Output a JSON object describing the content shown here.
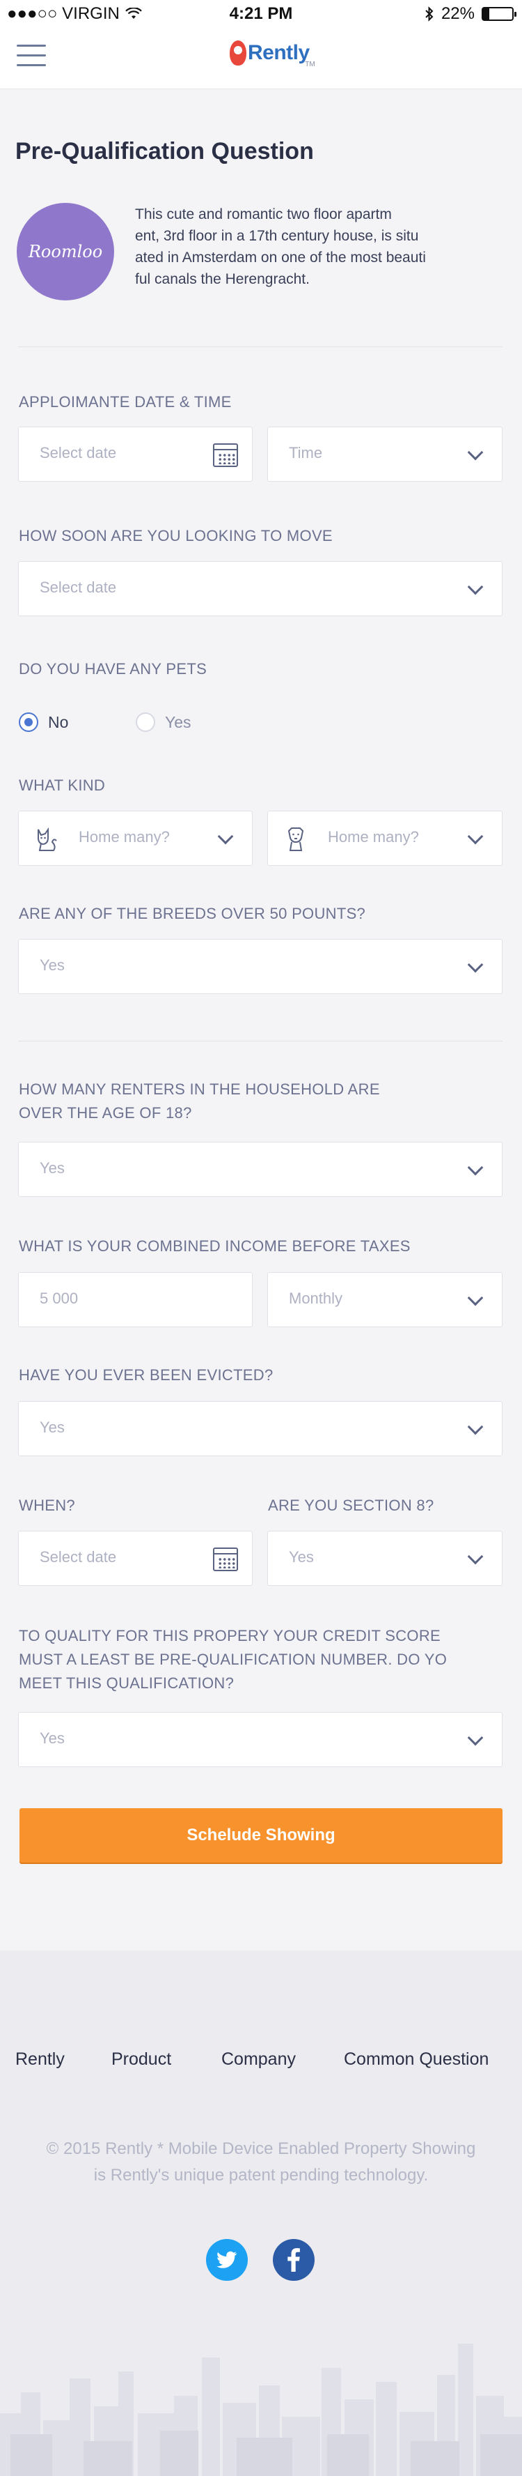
{
  "status": {
    "carrier": "●●●○○ VIRGIN",
    "time": "4:21 PM",
    "battery": "22%",
    "battery_level": 0.22
  },
  "brand": {
    "name": "Rently",
    "tm": "TM"
  },
  "page_title": "Pre-Qualification Question",
  "profile": {
    "avatar_text": "Roomloo",
    "lines": [
      "This cute and romantic two floor apartm",
      "ent, 3rd floor in a 17th century house, is situ",
      "ated in  Amsterdam on one of the most beauti",
      "ful canals  the Herengracht."
    ]
  },
  "appointment": {
    "label": "APPLOIMANTE DATE & TIME",
    "date_placeholder": "Select date",
    "time_placeholder": "Time"
  },
  "move": {
    "label": "HOW SOON ARE YOU LOOKING TO MOVE",
    "placeholder": "Select date"
  },
  "pets": {
    "label": "DO YOU HAVE ANY PETS",
    "options": [
      "No",
      "Yes"
    ],
    "selected": "No"
  },
  "kind": {
    "label": "WHAT KIND",
    "cat_placeholder": "Home many?",
    "dog_placeholder": "Home many?"
  },
  "breeds": {
    "label": "ARE ANY OF THE BREEDS OVER 50 POUNTS?",
    "value": "Yes"
  },
  "renters": {
    "label_line1": "HOW MANY RENTERS IN THE HOUSEHOLD ARE",
    "label_line2": "OVER THE AGE OF 18?",
    "value": "Yes"
  },
  "income": {
    "label": "WHAT IS YOUR COMBINED INCOME BEFORE TAXES",
    "amount": "5 000",
    "period": "Monthly"
  },
  "evicted": {
    "label": "HAVE YOU EVER BEEN EVICTED?",
    "value": "Yes"
  },
  "when": {
    "label": "WHEN?",
    "placeholder": "Select date"
  },
  "section8": {
    "label": "ARE YOU SECTION 8?",
    "value": "Yes"
  },
  "credit": {
    "label_line1": "TO QUALITY FOR THIS PROPERY YOUR CREDIT SCORE",
    "label_line2": "MUST A LEAST BE PRE-QUALIFICATION NUMBER. DO YO",
    "label_line3": "MEET THIS QUALIFICATION?",
    "value": "Yes"
  },
  "cta": {
    "label": "Schelude Showing"
  },
  "footer": {
    "nav": [
      "Rently",
      "Product",
      "Company",
      "Common Question"
    ],
    "copyright_line1": "© 2015 Rently * Mobile Device Enabled Property Showing",
    "copyright_line2": "is Rently's unique patent pending technology.",
    "social": [
      "twitter-icon",
      "facebook-icon"
    ]
  },
  "colors": {
    "accent": "#f7922d",
    "primary": "#4b76d1",
    "avatar": "#8f78cc",
    "twitter": "#1da1f2",
    "facebook": "#2b5aa7"
  }
}
